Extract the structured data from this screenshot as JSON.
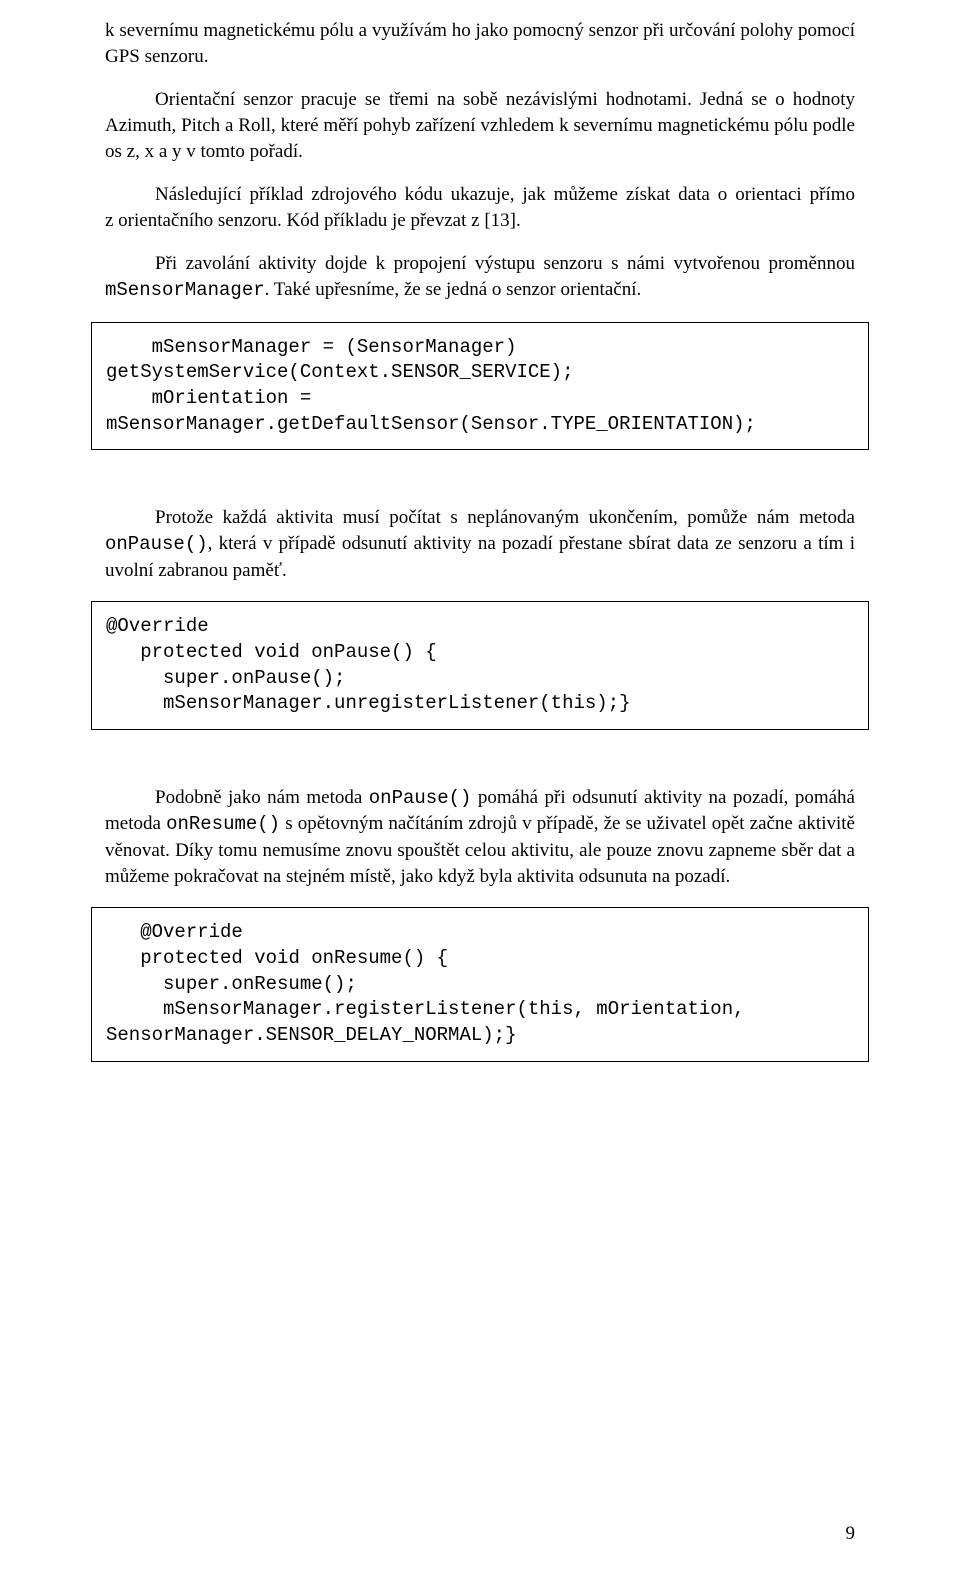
{
  "para1": "k severnímu magnetickému pólu a využívám ho jako pomocný senzor při určování polohy pomocí GPS senzoru.",
  "para2": "Orientační senzor pracuje se třemi na sobě nezávislými hodnotami. Jedná se o hodnoty Azimuth, Pitch a Roll, které měří pohyb zařízení vzhledem k severnímu magnetickému pólu podle os z, x a y v tomto pořadí.",
  "para3": "Následující příklad zdrojového kódu ukazuje, jak můžeme získat data o orientaci přímo z orientačního senzoru. Kód příkladu je převzat z [13].",
  "para4_a": "Při zavolání aktivity dojde k propojení výstupu senzoru s námi vytvořenou proměnnou ",
  "para4_code": "mSensorManager",
  "para4_b": ". Také upřesníme, že se jedná o senzor orientační.",
  "codebox1": "    mSensorManager = (SensorManager)\ngetSystemService(Context.SENSOR_SERVICE);\n    mOrientation =\nmSensorManager.getDefaultSensor(Sensor.TYPE_ORIENTATION);",
  "para5_a": "Protože každá aktivita musí počítat s neplánovaným ukončením, pomůže nám metoda ",
  "para5_code": "onPause()",
  "para5_b": ", která v případě odsunutí aktivity na pozadí přestane sbírat data ze senzoru a tím i uvolní zabranou paměť.",
  "codebox2": "@Override\n   protected void onPause() {\n     super.onPause();\n     mSensorManager.unregisterListener(this);}",
  "para6_a": "Podobně jako nám metoda ",
  "para6_code1": "onPause()",
  "para6_b": " pomáhá při odsunutí aktivity na pozadí, pomáhá metoda ",
  "para6_code2": "onResume()",
  "para6_c": " s opětovným načítáním zdrojů v případě, že se uživatel opět začne aktivitě věnovat. Díky tomu nemusíme znovu spouštět celou aktivitu, ale pouze znovu zapneme sběr dat a můžeme pokračovat na stejném místě, jako když byla aktivita odsunuta na pozadí.",
  "codebox3": "   @Override\n   protected void onResume() {\n     super.onResume();\n     mSensorManager.registerListener(this, mOrientation,\nSensorManager.SENSOR_DELAY_NORMAL);}",
  "page_number": "9"
}
